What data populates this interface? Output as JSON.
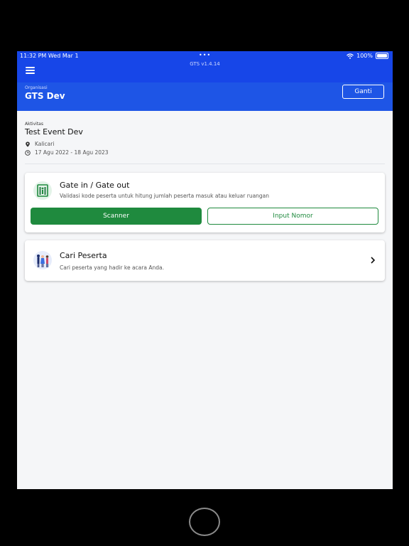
{
  "status": {
    "time": "11:32 PM   Wed Mar 1",
    "battery": "100%"
  },
  "app": {
    "version": "GTS v1.4.14"
  },
  "org": {
    "label": "Organisasi",
    "name": "GTS Dev",
    "switch_label": "Ganti"
  },
  "activity": {
    "label": "Aktivitas",
    "title": "Test Event Dev",
    "location": "Kalicari",
    "dates": "17 Agu 2022 - 18 Agu 2023"
  },
  "gate_card": {
    "title": "Gate in / Gate out",
    "description": "Validasi kode peserta untuk hitung jumlah peserta masuk atau keluar ruangan",
    "scanner_label": "Scanner",
    "input_label": "Input Nomor",
    "icon": "gate-scanner-icon"
  },
  "search_card": {
    "title": "Cari Peserta",
    "description": "Cari peserta yang hadir ke acara Anda.",
    "icon": "people-icon"
  },
  "colors": {
    "primary": "#1746e8",
    "accent": "#1f8a3e"
  }
}
